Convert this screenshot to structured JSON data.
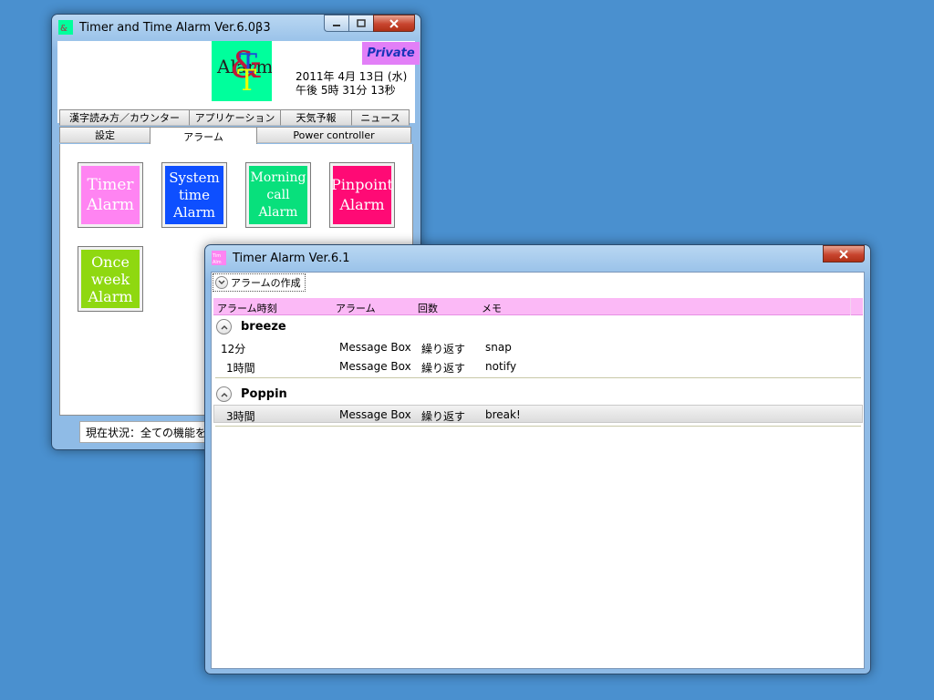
{
  "win1": {
    "title": "Timer and Time Alarm Ver.6.0β3",
    "private_label": "Private",
    "logo_text": {
      "a": "Alarm",
      "b": "&",
      "c": "T",
      "d": "T"
    },
    "date": "2011年 4月 13日 (水)",
    "time": "午後 5時 31分 13秒",
    "tabs_row1": [
      "漢字読み方／カウンター",
      "アプリケーション",
      "天気予報",
      "ニュース"
    ],
    "tabs_row2": [
      "設定",
      "アラーム",
      "Power controller"
    ],
    "alarm_buttons": [
      {
        "label": "Timer Alarm",
        "color": "#ff84f2"
      },
      {
        "label": "System time Alarm",
        "color": "#0e4fff"
      },
      {
        "label": "Morning call Alarm",
        "color": "#08e07c"
      },
      {
        "label": "Pinpoint Alarm",
        "color": "#ff0a75"
      },
      {
        "label": "Once week Alarm",
        "color": "#8fd810"
      }
    ],
    "status": "現在状況：全ての機能を使"
  },
  "win2": {
    "title": "Timer Alarm Ver.6.1",
    "create_label": "アラームの作成",
    "columns": [
      "アラーム時刻",
      "アラーム",
      "回数",
      "メモ"
    ],
    "groups": [
      {
        "name": "breeze",
        "rows": [
          {
            "time": "12分",
            "alarm": "Message Box",
            "count": "繰り返す",
            "memo": "snap"
          },
          {
            "time": "1時間",
            "alarm": "Message Box",
            "count": "繰り返す",
            "memo": "notify"
          }
        ]
      },
      {
        "name": "Poppin",
        "rows": [
          {
            "time": "3時間",
            "alarm": "Message Box",
            "count": "繰り返す",
            "memo": "break!"
          }
        ]
      }
    ]
  },
  "colors": {
    "desktop": "#4a90cf",
    "header_pink": "#fbb9f6",
    "private_badge": "#e27ff7",
    "logo_bg": "#00ff9c"
  }
}
